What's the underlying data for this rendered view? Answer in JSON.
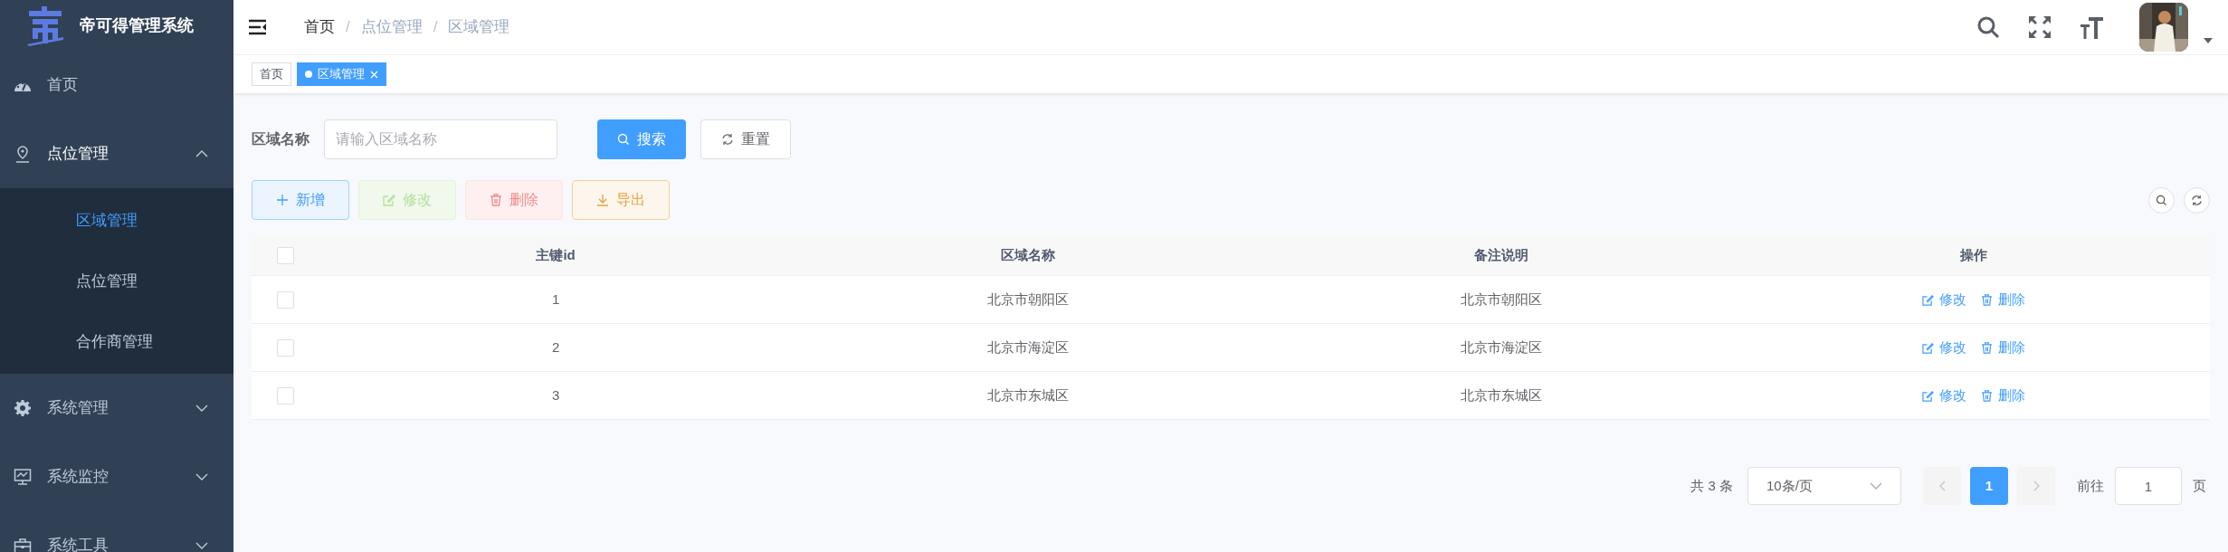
{
  "sidebar": {
    "logo_text": "帝可得管理系统",
    "items": [
      {
        "label": "首页",
        "expanded": false,
        "selected": false
      },
      {
        "label": "点位管理",
        "expanded": true,
        "selected": false,
        "children": [
          {
            "label": "区域管理",
            "selected": true
          },
          {
            "label": "点位管理",
            "selected": false
          },
          {
            "label": "合作商管理",
            "selected": false
          }
        ]
      },
      {
        "label": "系统管理",
        "expanded": false,
        "selected": false
      },
      {
        "label": "系统监控",
        "expanded": false,
        "selected": false
      },
      {
        "label": "系统工具",
        "expanded": false,
        "selected": false
      }
    ]
  },
  "breadcrumb": {
    "separator": "/",
    "items": [
      "首页",
      "点位管理",
      "区域管理"
    ]
  },
  "tabs": [
    {
      "label": "首页",
      "selected": false
    },
    {
      "label": "区域管理",
      "selected": true
    }
  ],
  "search_form": {
    "label": "区域名称",
    "placeholder": "请输入区域名称",
    "buttons": [
      {
        "label": "搜索",
        "kind": "primary"
      },
      {
        "label": "重置",
        "kind": "default"
      }
    ]
  },
  "toolbar": [
    {
      "label": "新增",
      "kind": "add",
      "disabled": false
    },
    {
      "label": "修改",
      "kind": "edit",
      "disabled": true
    },
    {
      "label": "删除",
      "kind": "delete",
      "disabled": true
    },
    {
      "label": "导出",
      "kind": "export",
      "disabled": false
    }
  ],
  "table": {
    "select_all_checked": false,
    "columns": [
      "主键id",
      "区域名称",
      "备注说明",
      "操作"
    ],
    "rows": [
      {
        "checked": false,
        "cells": [
          "1",
          "北京市朝阳区",
          "北京市朝阳区"
        ],
        "actions": [
          "修改",
          "删除"
        ]
      },
      {
        "checked": false,
        "cells": [
          "2",
          "北京市海淀区",
          "北京市海淀区"
        ],
        "actions": [
          "修改",
          "删除"
        ]
      },
      {
        "checked": false,
        "cells": [
          "3",
          "北京市东城区",
          "北京市东城区"
        ],
        "actions": [
          "修改",
          "删除"
        ]
      }
    ]
  },
  "pagination": {
    "total": "共 3 条",
    "page_size": "10条/页",
    "pages": [
      {
        "label": "1",
        "selected": true
      }
    ],
    "goto_label": "前往",
    "goto_value": "1",
    "goto_suffix": "页"
  }
}
